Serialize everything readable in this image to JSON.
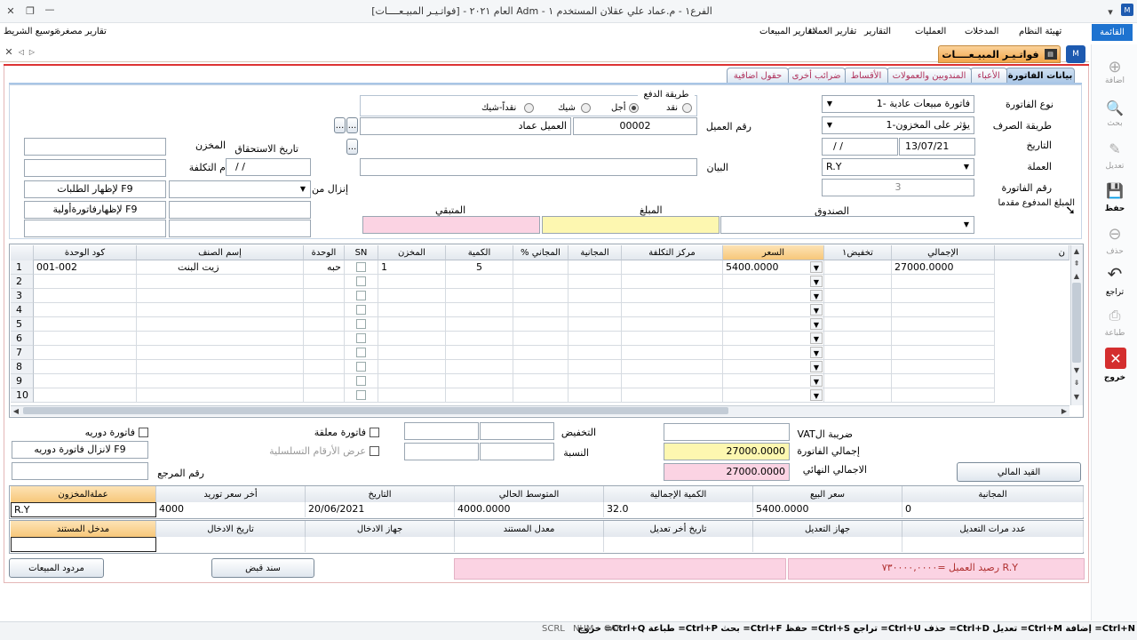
{
  "window": {
    "title": "الفرع١ - م.عماد علي عقلان  المستخدم ١ - Adm   العام  ٢٠٢١ - [فواتـيـر المبيـعــــات]"
  },
  "menu": {
    "items": [
      "القائمة",
      "تهيئة النظام",
      "المدخلات",
      "العمليات",
      "التقارير",
      "تقارير العملاء",
      "تقارير المبيعات"
    ],
    "left_items": [
      "تقارير مصغرة",
      "توسيع الشريط"
    ]
  },
  "doc_tab": {
    "label": "فواتـيـر المبيـعــــات"
  },
  "sidebar": {
    "items": [
      "اضافة",
      "بحث",
      "تعديل",
      "حفظ",
      "حذف",
      "تراجع",
      "طباعة",
      "خروج"
    ]
  },
  "tabs": [
    "بيانات الفاتورة",
    "الأعباء",
    "المندوبين والعمولات",
    "الأقساط",
    "ضرائب أخرى",
    "حقول اضافية"
  ],
  "form": {
    "invoice_type_label": "نوع الفاتورة",
    "invoice_type_value": "فاتورة مبيعات عادية -1",
    "disburse_label": "طريقة الصرف",
    "disburse_value": "يؤثر على المخزون-1",
    "date_label": "التاريخ",
    "date_value": "13/07/21",
    "date2_value": "/  /",
    "currency_label": "العملة",
    "currency_value": "R.Y",
    "invoice_no_label": "رقم الفاتورة",
    "invoice_no_value": "3",
    "paid_label": "المبلغ المدفوع مقدما",
    "payment_group_label": "طريقة الدفع",
    "payment_options": [
      "نقد",
      "أجل",
      "شيك",
      "نقداً-شيك"
    ],
    "customer_no_label": "رقم العميل",
    "customer_no_value": "00002",
    "customer_name_value": "العميل عماد",
    "statement_label": "البيان",
    "box_label": "الصندوق",
    "amount_label": "المبلغ",
    "remaining_label": "المتبقي",
    "due_date_label": "تاريخ الاستحقاق",
    "due_date_value": "/  /",
    "store_label": "المخزن",
    "cost_label": "م التكلفة",
    "download_label": "إنزال من",
    "show_orders": "F9 لإظهار الطلبات",
    "show_prelim": "F9  لإظهارفاتورةأولية"
  },
  "grid": {
    "columns": [
      "الإجمالي",
      "تخفيض١",
      "السعر",
      "مركز التكلفة",
      "المجانية",
      "% المجاني",
      "الكمية",
      "المخزن",
      "SN",
      "الوحدة",
      "إسم الصنف",
      "كود الوحدة"
    ],
    "rows": [
      {
        "num": "1",
        "total": "27000.0000",
        "disc": "",
        "price": "5400.0000",
        "cost_center": "",
        "free": "",
        "free_pct": "",
        "qty": "5",
        "store": "1",
        "unit": "حبه",
        "name": "زيت البنت",
        "code": "001-002"
      },
      {
        "num": "2"
      },
      {
        "num": "3"
      },
      {
        "num": "4"
      },
      {
        "num": "5"
      },
      {
        "num": "6"
      },
      {
        "num": "7"
      },
      {
        "num": "8"
      },
      {
        "num": "9"
      },
      {
        "num": "10"
      }
    ]
  },
  "footer": {
    "vat_label": "ضريبة الVAT",
    "invoice_total_label": "إجمالي الفاتورة",
    "invoice_total_value": "27000.0000",
    "final_total_label": "الاجمالي النهائي",
    "final_total_value": "27000.0000",
    "discount_label": "التخفيض",
    "ratio_label": "النسبة",
    "periodic_label": "فاتورة دوريه",
    "pending_label": "فاتورة معلقة",
    "serials_label": "عرض الأرقام التسلسلية",
    "periodic_hint": "F9 لانزال فاتورة دوريه",
    "ref_label": "رقم المرجع",
    "journal_button": "القيد المالي"
  },
  "info1": {
    "headers": [
      "المجانية",
      "سعر البيع",
      "الكمية الإجمالية",
      "المتوسط الحالي",
      "التاريخ",
      "أخر سعر توريد",
      "عملةالمخزون"
    ],
    "values": [
      "0",
      "5400.0000",
      "32.0",
      "4000.0000",
      "20/06/2021",
      "4000",
      "R.Y"
    ]
  },
  "info2": {
    "headers": [
      "عدد مرات التعديل",
      "جهاز التعديل",
      "تاريخ أخر تعديل",
      "معدل المستند",
      "جهاز الادخال",
      "تاريخ الادخال",
      "مدخل المستند"
    ]
  },
  "bottom": {
    "returns_button": "مردود المبيعات",
    "receipt_button": "سند قبض",
    "balance_text": "R.Y   رصيد العميل =٧٣٠٠٠٠,٠٠٠٠"
  },
  "statusbar": {
    "keys": "Ctrl+N= إضافة Ctrl+M= تعديل Ctrl+D= حذف Ctrl+U= تراجع Ctrl+S= حفظ Ctrl+F= بحث Ctrl+P= طباعة Ctrl+Q= خروج",
    "indicators": [
      "SCRL",
      "NUM",
      "CAP"
    ]
  },
  "colors": {
    "accent": "#cc3333",
    "tab_bar": "#f3a64a",
    "active_tab": "#a9c6e6",
    "pink": "#fbd3e3",
    "yellow": "#fdf7b0",
    "orange": "#fbd28c"
  }
}
